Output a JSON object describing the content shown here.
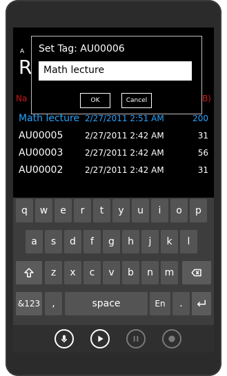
{
  "app": {
    "title_small": "A",
    "title_big": "R",
    "header_left": "Na",
    "header_right": "B)"
  },
  "recordings": [
    {
      "name": "Math lecture",
      "date": "2/27/2011 2:51 AM",
      "size": "200"
    },
    {
      "name": "AU00005",
      "date": "2/27/2011 2:42 AM",
      "size": "31"
    },
    {
      "name": "AU00003",
      "date": "2/27/2011 2:42 AM",
      "size": "56"
    },
    {
      "name": "AU00002",
      "date": "2/27/2011 2:42 AM",
      "size": "31"
    }
  ],
  "dialog": {
    "title": "Set Tag: AU00006",
    "input_value": "Math lecture",
    "ok_label": "OK",
    "cancel_label": "Cancel"
  },
  "keyboard": {
    "row1": [
      "q",
      "w",
      "e",
      "r",
      "t",
      "y",
      "u",
      "i",
      "o",
      "p"
    ],
    "row2": [
      "a",
      "s",
      "d",
      "f",
      "g",
      "h",
      "j",
      "k",
      "l"
    ],
    "row3": [
      "z",
      "x",
      "c",
      "v",
      "b",
      "n",
      "m"
    ],
    "numbers_label": "&123",
    "comma_label": ",",
    "space_label": "space",
    "lang_label": "En",
    "period_label": "."
  },
  "icons": {
    "shift": "shift-icon",
    "backspace": "backspace-icon",
    "enter": "enter-icon",
    "mic": "microphone-icon",
    "play": "play-icon",
    "pause": "pause-icon",
    "record": "record-icon"
  }
}
